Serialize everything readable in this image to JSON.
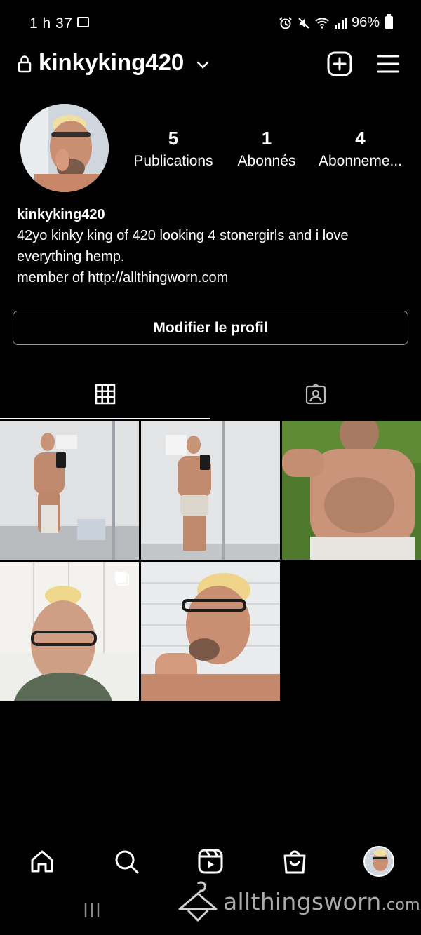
{
  "status": {
    "time": "1 h 37",
    "battery": "96%"
  },
  "header": {
    "username": "kinkyking420"
  },
  "stats": {
    "posts_count": "5",
    "posts_label": "Publications",
    "followers_count": "1",
    "followers_label": "Abonnés",
    "following_count": "4",
    "following_label": "Abonneme..."
  },
  "bio": {
    "name": "kinkyking420",
    "line1": "42yo kinky king of 420 looking 4 stonergirls and i love",
    "line2": "everything hemp.",
    "line3": "member of http://allthingworn.com"
  },
  "profile": {
    "edit_label": "Modifier le profil"
  },
  "tabs": [
    "grid-icon",
    "tagged-icon"
  ],
  "watermark": {
    "text": "allthingsworn",
    "tld": ".com"
  },
  "colors": {
    "background": "#000000",
    "text": "#ffffff",
    "button_border": "#9a9a9a"
  }
}
